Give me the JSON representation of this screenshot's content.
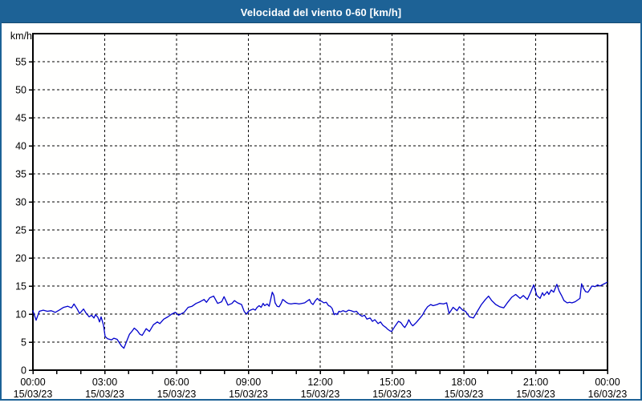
{
  "window": {
    "title": "Velocidad del viento 0-60 [km/h]"
  },
  "colors": {
    "titlebar_bg": "#1d6296",
    "frame": "#1d6296",
    "plot_background": "#fffffe",
    "plot_border": "#000000",
    "grid": "#000000",
    "line": "#0000cc",
    "label_text": "#000000",
    "title_text": "#ffffff"
  },
  "chart_data": {
    "type": "line",
    "title": "Velocidad del viento 0-60 [km/h]",
    "ylabel": "km/h",
    "ylim": [
      0,
      60
    ],
    "yticks": [
      0,
      5,
      10,
      15,
      20,
      25,
      30,
      35,
      40,
      45,
      50,
      55
    ],
    "grid": "dashed",
    "legend_position": "none",
    "x_range_hours": [
      0,
      24
    ],
    "x_minor_tick_hours": 1,
    "x_ticks": [
      {
        "hours": 0,
        "time": "00:00",
        "date": "15/03/23"
      },
      {
        "hours": 3,
        "time": "03:00",
        "date": "15/03/23"
      },
      {
        "hours": 6,
        "time": "06:00",
        "date": "15/03/23"
      },
      {
        "hours": 9,
        "time": "09:00",
        "date": "15/03/23"
      },
      {
        "hours": 12,
        "time": "12:00",
        "date": "15/03/23"
      },
      {
        "hours": 15,
        "time": "15:00",
        "date": "15/03/23"
      },
      {
        "hours": 18,
        "time": "18:00",
        "date": "15/03/23"
      },
      {
        "hours": 21,
        "time": "21:00",
        "date": "15/03/23"
      },
      {
        "hours": 24,
        "time": "00:00",
        "date": "16/03/23"
      }
    ],
    "series": [
      {
        "name": "Velocidad del viento",
        "color": "#0000cc",
        "x_unit": "minutes_since_00:00_15/03/23",
        "y_unit": "km/h",
        "points": [
          [
            0,
            10.6
          ],
          [
            8,
            8.9
          ],
          [
            16,
            10.5
          ],
          [
            26,
            10.7
          ],
          [
            36,
            10.5
          ],
          [
            46,
            10.6
          ],
          [
            56,
            10.3
          ],
          [
            66,
            10.7
          ],
          [
            77,
            11.2
          ],
          [
            87,
            11.4
          ],
          [
            97,
            11.1
          ],
          [
            103,
            11.8
          ],
          [
            111,
            10.9
          ],
          [
            117,
            10.1
          ],
          [
            127,
            10.9
          ],
          [
            133,
            10.2
          ],
          [
            141,
            9.5
          ],
          [
            147,
            9.8
          ],
          [
            153,
            9.3
          ],
          [
            157,
            9.9
          ],
          [
            163,
            9.4
          ],
          [
            167,
            8.6
          ],
          [
            171,
            9.5
          ],
          [
            177,
            8.0
          ],
          [
            181,
            6.0
          ],
          [
            187,
            5.6
          ],
          [
            197,
            5.4
          ],
          [
            203,
            5.7
          ],
          [
            211,
            5.5
          ],
          [
            222,
            4.3
          ],
          [
            228,
            3.9
          ],
          [
            234,
            5.0
          ],
          [
            242,
            6.4
          ],
          [
            248,
            6.9
          ],
          [
            254,
            7.5
          ],
          [
            262,
            7.0
          ],
          [
            268,
            6.4
          ],
          [
            274,
            6.2
          ],
          [
            284,
            7.4
          ],
          [
            292,
            6.9
          ],
          [
            302,
            8.1
          ],
          [
            312,
            8.6
          ],
          [
            318,
            8.3
          ],
          [
            328,
            9.1
          ],
          [
            338,
            9.5
          ],
          [
            348,
            10.0
          ],
          [
            357,
            10.3
          ],
          [
            365,
            9.8
          ],
          [
            373,
            10.1
          ],
          [
            379,
            10.3
          ],
          [
            389,
            11.2
          ],
          [
            399,
            11.4
          ],
          [
            409,
            11.9
          ],
          [
            419,
            12.2
          ],
          [
            429,
            12.6
          ],
          [
            435,
            12.1
          ],
          [
            443,
            12.9
          ],
          [
            453,
            13.2
          ],
          [
            463,
            11.9
          ],
          [
            473,
            12.2
          ],
          [
            479,
            13.1
          ],
          [
            489,
            11.6
          ],
          [
            499,
            11.9
          ],
          [
            505,
            12.4
          ],
          [
            513,
            12.0
          ],
          [
            523,
            11.7
          ],
          [
            530,
            10.4
          ],
          [
            536,
            10.0
          ],
          [
            540,
            10.5
          ],
          [
            545,
            10.7
          ],
          [
            552,
            10.9
          ],
          [
            557,
            10.7
          ],
          [
            562,
            11.2
          ],
          [
            567,
            11.5
          ],
          [
            572,
            11.2
          ],
          [
            577,
            11.9
          ],
          [
            581,
            11.5
          ],
          [
            587,
            11.8
          ],
          [
            592,
            11.4
          ],
          [
            600,
            13.9
          ],
          [
            604,
            13.3
          ],
          [
            607,
            12.0
          ],
          [
            612,
            11.4
          ],
          [
            617,
            11.3
          ],
          [
            622,
            11.9
          ],
          [
            626,
            12.6
          ],
          [
            630,
            12.4
          ],
          [
            635,
            12.1
          ],
          [
            640,
            11.9
          ],
          [
            647,
            11.8
          ],
          [
            654,
            11.9
          ],
          [
            660,
            11.9
          ],
          [
            667,
            11.8
          ],
          [
            674,
            11.9
          ],
          [
            681,
            12.0
          ],
          [
            687,
            12.3
          ],
          [
            693,
            12.6
          ],
          [
            697,
            12.0
          ],
          [
            702,
            11.7
          ],
          [
            708,
            12.4
          ],
          [
            713,
            12.8
          ],
          [
            718,
            12.4
          ],
          [
            723,
            12.3
          ],
          [
            729,
            12.0
          ],
          [
            735,
            12.1
          ],
          [
            741,
            11.5
          ],
          [
            745,
            11.4
          ],
          [
            750,
            11.0
          ],
          [
            755,
            9.9
          ],
          [
            759,
            10.1
          ],
          [
            762,
            9.9
          ],
          [
            767,
            10.5
          ],
          [
            771,
            10.4
          ],
          [
            777,
            10.6
          ],
          [
            785,
            10.4
          ],
          [
            791,
            10.7
          ],
          [
            797,
            10.6
          ],
          [
            805,
            10.4
          ],
          [
            811,
            10.5
          ],
          [
            817,
            10.0
          ],
          [
            825,
            9.6
          ],
          [
            831,
            9.8
          ],
          [
            837,
            9.1
          ],
          [
            845,
            9.3
          ],
          [
            851,
            8.7
          ],
          [
            857,
            9.0
          ],
          [
            865,
            8.3
          ],
          [
            871,
            8.6
          ],
          [
            877,
            8.0
          ],
          [
            885,
            7.6
          ],
          [
            889,
            7.3
          ],
          [
            895,
            7.0
          ],
          [
            899,
            6.9
          ],
          [
            908,
            7.9
          ],
          [
            912,
            8.3
          ],
          [
            916,
            8.7
          ],
          [
            922,
            8.5
          ],
          [
            928,
            7.9
          ],
          [
            932,
            7.6
          ],
          [
            938,
            8.3
          ],
          [
            942,
            9.0
          ],
          [
            948,
            8.2
          ],
          [
            952,
            7.9
          ],
          [
            958,
            8.3
          ],
          [
            962,
            8.6
          ],
          [
            968,
            9.1
          ],
          [
            976,
            9.8
          ],
          [
            983,
            10.7
          ],
          [
            989,
            11.3
          ],
          [
            997,
            11.7
          ],
          [
            1003,
            11.5
          ],
          [
            1013,
            11.7
          ],
          [
            1019,
            11.9
          ],
          [
            1029,
            11.8
          ],
          [
            1037,
            12.0
          ],
          [
            1043,
            10.1
          ],
          [
            1053,
            11.2
          ],
          [
            1063,
            10.6
          ],
          [
            1069,
            11.3
          ],
          [
            1077,
            10.7
          ],
          [
            1084,
            10.5
          ],
          [
            1094,
            9.5
          ],
          [
            1104,
            9.3
          ],
          [
            1114,
            10.5
          ],
          [
            1124,
            11.7
          ],
          [
            1134,
            12.6
          ],
          [
            1142,
            13.2
          ],
          [
            1150,
            12.4
          ],
          [
            1160,
            11.7
          ],
          [
            1170,
            11.3
          ],
          [
            1180,
            11.1
          ],
          [
            1190,
            12.1
          ],
          [
            1200,
            13.0
          ],
          [
            1210,
            13.5
          ],
          [
            1221,
            12.8
          ],
          [
            1229,
            13.3
          ],
          [
            1239,
            12.6
          ],
          [
            1247,
            13.8
          ],
          [
            1255,
            15.2
          ],
          [
            1263,
            13.3
          ],
          [
            1271,
            12.8
          ],
          [
            1277,
            13.8
          ],
          [
            1281,
            13.3
          ],
          [
            1289,
            14.0
          ],
          [
            1293,
            13.5
          ],
          [
            1299,
            14.3
          ],
          [
            1305,
            13.9
          ],
          [
            1313,
            15.3
          ],
          [
            1319,
            14.1
          ],
          [
            1325,
            13.3
          ],
          [
            1331,
            12.4
          ],
          [
            1339,
            12.0
          ],
          [
            1345,
            12.1
          ],
          [
            1351,
            12.0
          ],
          [
            1359,
            12.2
          ],
          [
            1365,
            12.5
          ],
          [
            1371,
            12.8
          ],
          [
            1375,
            15.4
          ],
          [
            1379,
            14.7
          ],
          [
            1385,
            14.0
          ],
          [
            1391,
            13.9
          ],
          [
            1395,
            14.3
          ],
          [
            1401,
            15.0
          ],
          [
            1409,
            14.9
          ],
          [
            1415,
            15.2
          ],
          [
            1421,
            15.0
          ],
          [
            1429,
            15.3
          ],
          [
            1435,
            15.5
          ],
          [
            1439,
            15.7
          ]
        ]
      }
    ]
  }
}
